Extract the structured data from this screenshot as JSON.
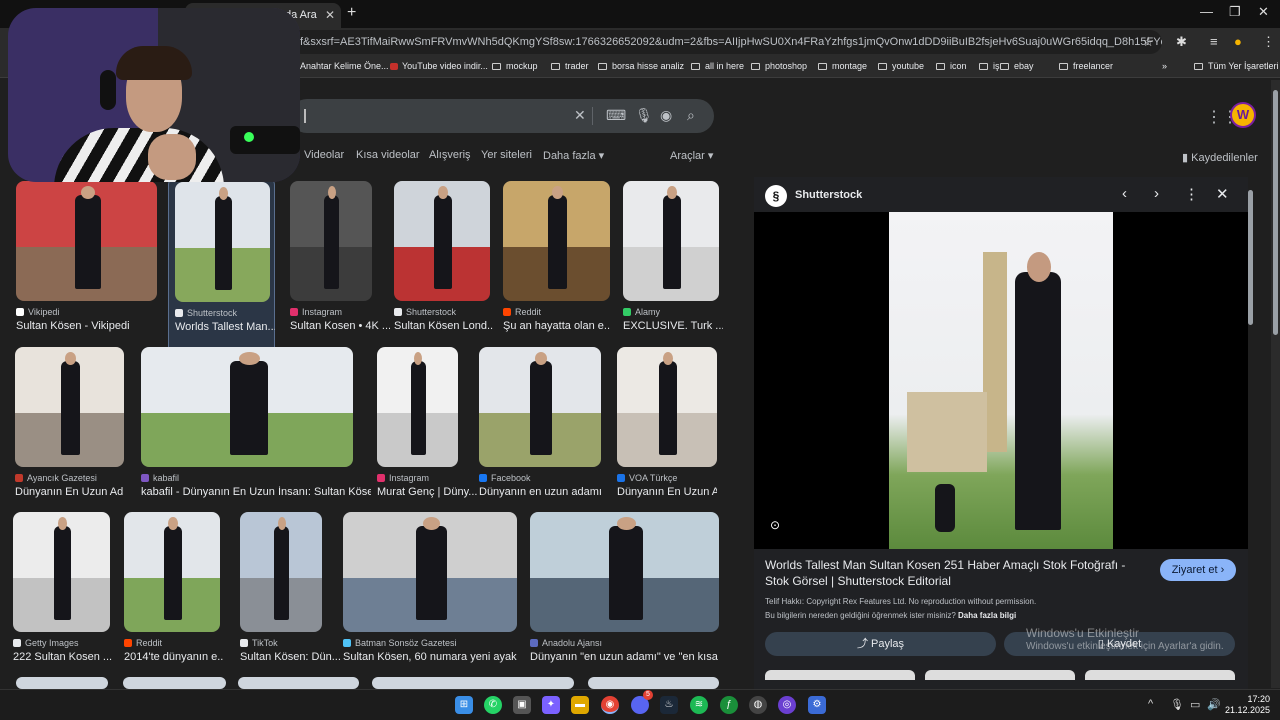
{
  "browser": {
    "tab_title": "da Ara",
    "address": "f&sxsrf=AE3TifMaiRwwSmFRVmvWNh5dQKmgYSf8sw:1766326652092&udm=2&fbs=AIIjpHwSU0Xn4FRaYzhfgs1jmQvOnw1dDD9iiBuIB2fsjeHv6Suaj0uWGr65idqq_D8h15FYdr_s8gfpDi9F22MheIAWr-gO...",
    "bookmarks": [
      {
        "label": "Anahtar Kelime Öne...",
        "kind": "plain"
      },
      {
        "label": "YouTube video indir...",
        "kind": "youtube"
      },
      {
        "label": "mockup",
        "kind": "folder"
      },
      {
        "label": "trader",
        "kind": "folder"
      },
      {
        "label": "borsa hisse analiz",
        "kind": "folder"
      },
      {
        "label": "all in here",
        "kind": "folder"
      },
      {
        "label": "photoshop",
        "kind": "folder"
      },
      {
        "label": "montage",
        "kind": "folder"
      },
      {
        "label": "youtube",
        "kind": "folder"
      },
      {
        "label": "icon",
        "kind": "folder"
      },
      {
        "label": "iş",
        "kind": "folder"
      },
      {
        "label": "ebay",
        "kind": "folder"
      },
      {
        "label": "freelancer",
        "kind": "folder"
      }
    ],
    "all_bookmarks": "Tüm Yer İşaretleri"
  },
  "search": {
    "filters": [
      "Videolar",
      "Kısa videolar",
      "Alışveriş",
      "Yer siteleri",
      "Daha fazla"
    ],
    "tools": "Araçlar",
    "saved": "Kaydedilenler"
  },
  "results": [
    {
      "source": "Vikipedi",
      "title": "Sultan Kösen - Vikipedi",
      "fav": "#ffffff"
    },
    {
      "source": "Shutterstock",
      "title": "Worlds Tallest Man...",
      "fav": "#e8eaed"
    },
    {
      "source": "Instagram",
      "title": "Sultan Kosen • 4K ...",
      "fav": "#e1306c"
    },
    {
      "source": "Shutterstock",
      "title": "Sultan Kösen Lond...",
      "fav": "#e8eaed"
    },
    {
      "source": "Reddit",
      "title": "Şu an hayatta olan e...",
      "fav": "#ff4500"
    },
    {
      "source": "Alamy",
      "title": "EXCLUSIVE. Turk ...",
      "fav": "#33cc66"
    },
    {
      "source": "Ayancık Gazetesi",
      "title": "Dünyanın En Uzun Ad...",
      "fav": "#c0392b"
    },
    {
      "source": "kabafil",
      "title": "kabafil - Dünyanın En Uzun İnsanı: Sultan Kösen",
      "fav": "#7e57c2"
    },
    {
      "source": "Instagram",
      "title": "Murat Genç | Düny...",
      "fav": "#e1306c"
    },
    {
      "source": "Facebook",
      "title": "Dünyanın en uzun adamı...",
      "fav": "#1877f2"
    },
    {
      "source": "VOA Türkçe",
      "title": "Dünyanın En Uzun A...",
      "fav": "#1a73e8"
    },
    {
      "source": "Getty Images",
      "title": "222 Sultan Kosen ...",
      "fav": "#e8eaed"
    },
    {
      "source": "Reddit",
      "title": "2014'te dünyanın e...",
      "fav": "#ff4500"
    },
    {
      "source": "TikTok",
      "title": "Sultan Kösen: Dün...",
      "fav": "#e8eaed"
    },
    {
      "source": "Batman Sonsöz Gazetesi",
      "title": "Sultan Kösen, 60 numara yeni ayakk...",
      "fav": "#4fc3f7"
    },
    {
      "source": "Anadolu Ajansı",
      "title": "Dünyanın \"en uzun adamı\" ve \"en kısa k...",
      "fav": "#5c6bc0"
    }
  ],
  "panel": {
    "site": "Shutterstock",
    "logo_glyph": "§",
    "title": "Worlds Tallest Man Sultan Kosen 251 Haber Amaçlı Stok Fotoğrafı - Stok Görsel | Shutterstock Editorial",
    "visit": "Ziyaret et",
    "copyright": "Telif Hakkı: Copyright Rex Features Ltd. No reproduction without permission.",
    "learn_prefix": "Bu bilgilerin nereden geldiğini öğrenmek ister misiniz?",
    "learn_link": "Daha fazla bilgi",
    "share": "Paylaş",
    "save": "Kaydet"
  },
  "watermark": {
    "line1": "Windows'u Etkinleştir",
    "line2": "Windows'u etkinleştirmek için Ayarlar'a gidin."
  },
  "taskbar": {
    "time": "17:20",
    "date": "21.12.2025",
    "discord_badge": "5"
  },
  "colors": {
    "accent": "#8ab4f8",
    "panel_bg": "#202124",
    "page_bg": "#1f1f1f"
  }
}
